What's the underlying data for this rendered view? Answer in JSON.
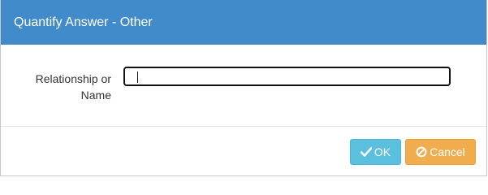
{
  "dialog": {
    "title": "Quantify Answer - Other",
    "header_color": "#428bca"
  },
  "form": {
    "label": "Relationship or Name",
    "value": "",
    "placeholder": ""
  },
  "buttons": {
    "ok": {
      "label": "OK",
      "icon": "check-icon",
      "color": "#5bc0de"
    },
    "cancel": {
      "label": "Cancel",
      "icon": "ban-icon",
      "color": "#f0ad4e"
    }
  }
}
